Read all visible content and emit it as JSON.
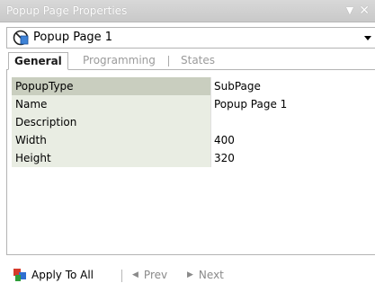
{
  "window": {
    "title": "Popup Page Properties",
    "pin_icon": "dropdown-arrow-icon",
    "close_icon": "close-icon"
  },
  "selector": {
    "value": "Popup Page 1",
    "icon": "popup-page-icon"
  },
  "tabs": [
    {
      "label": "General",
      "active": true
    },
    {
      "label": "Programming",
      "active": false
    },
    {
      "label": "States",
      "active": false
    }
  ],
  "properties": [
    {
      "name": "PopupType",
      "value": "SubPage",
      "selected": true
    },
    {
      "name": "Name",
      "value": "Popup Page 1",
      "selected": false
    },
    {
      "name": "Description",
      "value": "",
      "selected": false
    },
    {
      "name": "Width",
      "value": "400",
      "selected": false
    },
    {
      "name": "Height",
      "value": "320",
      "selected": false
    }
  ],
  "toolbar": {
    "apply_label": "Apply To All",
    "prev_label": "Prev",
    "next_label": "Next"
  },
  "colors": {
    "selected_row": "#c9cebf",
    "name_column": "#e9ede3"
  }
}
